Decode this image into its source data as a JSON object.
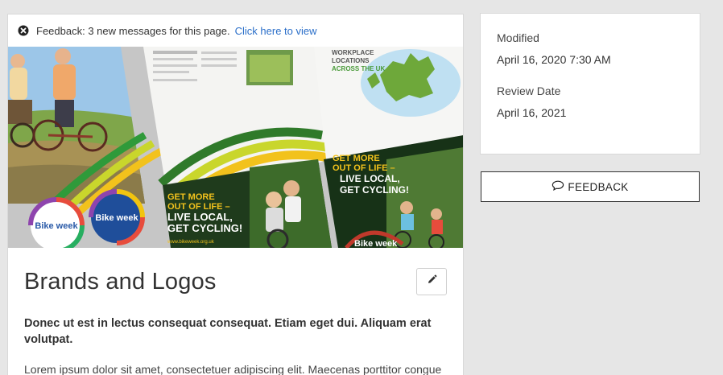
{
  "feedback_bar": {
    "message": "Feedback: 3 new messages for this page.",
    "link_text": "Click here to view",
    "close_icon": "x-circle-icon"
  },
  "hero": {
    "badge_text_1": "Bike week",
    "badge_text_2": "Bike week",
    "flyer_1_line_1": "GET MORE",
    "flyer_1_line_2": "OUT OF LIFE –",
    "flyer_1_line_3": "LIVE LOCAL,",
    "flyer_1_line_4": "GET CYCLING!",
    "flyer_2_line_1": "GET MORE",
    "flyer_2_line_2": "OUT OF LIFE –",
    "flyer_2_line_3": "LIVE LOCAL,",
    "flyer_2_line_4": "GET CYCLING!",
    "flyer_1_url": "www.bikeweek.org.uk",
    "brochure_heading_1": "WORKPLACE",
    "brochure_heading_2": "LOCATIONS",
    "brochure_heading_3": "ACROSS THE UK",
    "brochure_logo": "Bike week"
  },
  "main": {
    "title": "Brands and Logos",
    "edit_icon": "pencil-icon",
    "lead": "Donec ut est in lectus consequat consequat. Etiam eget dui. Aliquam erat volutpat.",
    "body": "Lorem ipsum dolor sit amet, consectetuer adipiscing elit. Maecenas porttitor congue"
  },
  "sidebar": {
    "modified_label": "Modified",
    "modified_value": "April 16, 2020 7:30 AM",
    "review_label": "Review Date",
    "review_value": "April 16, 2021"
  },
  "feedback_button": {
    "label": "FEEDBACK",
    "icon": "speech-bubble-icon"
  }
}
